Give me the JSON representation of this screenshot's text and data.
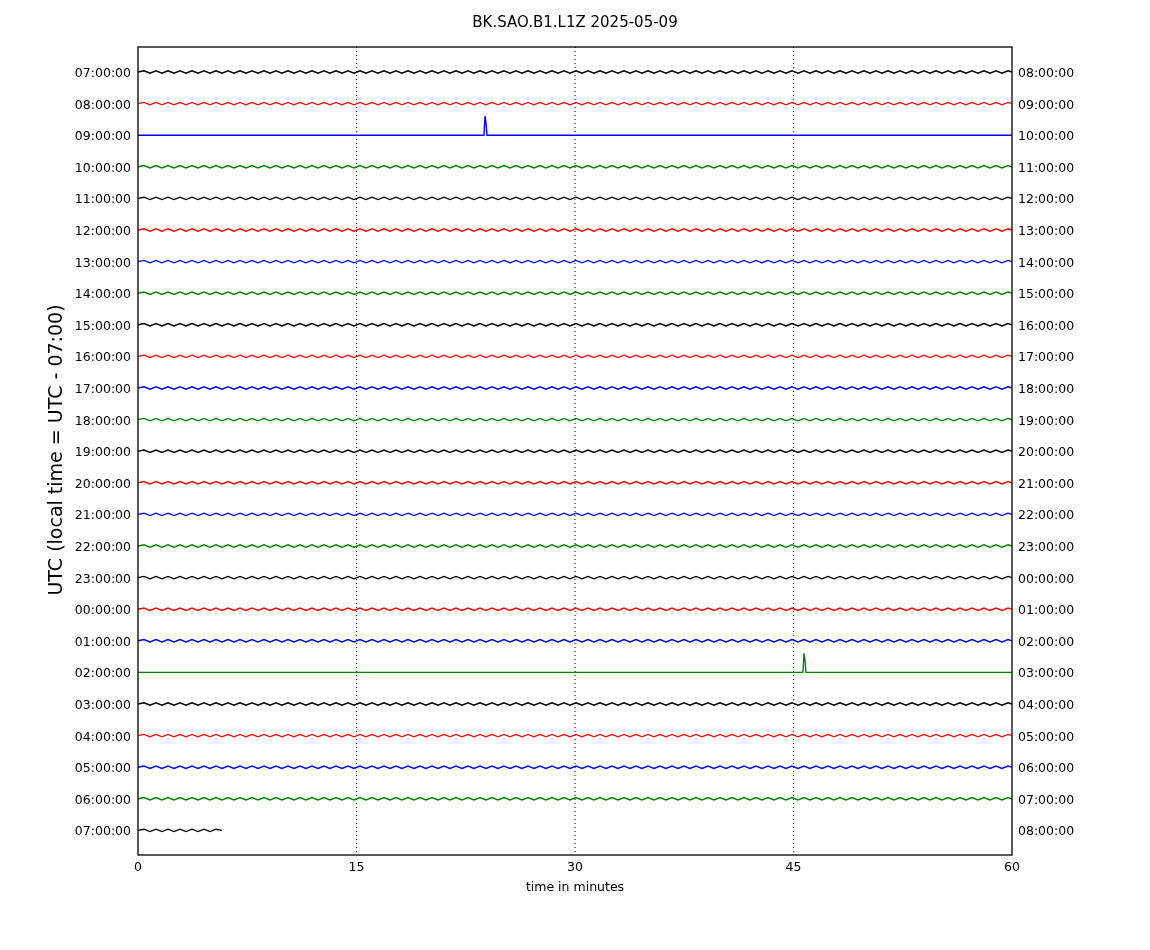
{
  "title": "BK.SAO.B1.L1Z 2025-05-09",
  "ylabel": "UTC (local time = UTC - 07:00)",
  "xlabel": "time in minutes",
  "xticks": [
    "0",
    "15",
    "30",
    "45",
    "60"
  ],
  "traces": [
    {
      "left": "07:00:00",
      "right": "08:00:00",
      "color": "#000000",
      "kind": "full"
    },
    {
      "left": "08:00:00",
      "right": "09:00:00",
      "color": "#ff0000",
      "kind": "full"
    },
    {
      "left": "09:00:00",
      "right": "10:00:00",
      "color": "#0000ff",
      "kind": "spike-mid"
    },
    {
      "left": "10:00:00",
      "right": "11:00:00",
      "color": "#008000",
      "kind": "full"
    },
    {
      "left": "11:00:00",
      "right": "12:00:00",
      "color": "#000000",
      "kind": "full"
    },
    {
      "left": "12:00:00",
      "right": "13:00:00",
      "color": "#ff0000",
      "kind": "full"
    },
    {
      "left": "13:00:00",
      "right": "14:00:00",
      "color": "#0000ff",
      "kind": "full"
    },
    {
      "left": "14:00:00",
      "right": "15:00:00",
      "color": "#008000",
      "kind": "full"
    },
    {
      "left": "15:00:00",
      "right": "16:00:00",
      "color": "#000000",
      "kind": "full"
    },
    {
      "left": "16:00:00",
      "right": "17:00:00",
      "color": "#ff0000",
      "kind": "full"
    },
    {
      "left": "17:00:00",
      "right": "18:00:00",
      "color": "#0000ff",
      "kind": "full"
    },
    {
      "left": "18:00:00",
      "right": "19:00:00",
      "color": "#008000",
      "kind": "full"
    },
    {
      "left": "19:00:00",
      "right": "20:00:00",
      "color": "#000000",
      "kind": "full"
    },
    {
      "left": "20:00:00",
      "right": "21:00:00",
      "color": "#ff0000",
      "kind": "full"
    },
    {
      "left": "21:00:00",
      "right": "22:00:00",
      "color": "#0000ff",
      "kind": "full"
    },
    {
      "left": "22:00:00",
      "right": "23:00:00",
      "color": "#008000",
      "kind": "full"
    },
    {
      "left": "23:00:00",
      "right": "00:00:00",
      "color": "#000000",
      "kind": "full"
    },
    {
      "left": "00:00:00",
      "right": "01:00:00",
      "color": "#ff0000",
      "kind": "full"
    },
    {
      "left": "01:00:00",
      "right": "02:00:00",
      "color": "#0000ff",
      "kind": "full"
    },
    {
      "left": "02:00:00",
      "right": "03:00:00",
      "color": "#008000",
      "kind": "spike-late"
    },
    {
      "left": "03:00:00",
      "right": "04:00:00",
      "color": "#000000",
      "kind": "full"
    },
    {
      "left": "04:00:00",
      "right": "05:00:00",
      "color": "#ff0000",
      "kind": "full"
    },
    {
      "left": "05:00:00",
      "right": "06:00:00",
      "color": "#0000ff",
      "kind": "full"
    },
    {
      "left": "06:00:00",
      "right": "07:00:00",
      "color": "#008000",
      "kind": "full"
    },
    {
      "left": "07:00:00",
      "right": "08:00:00",
      "color": "#000000",
      "kind": "partial"
    }
  ]
}
